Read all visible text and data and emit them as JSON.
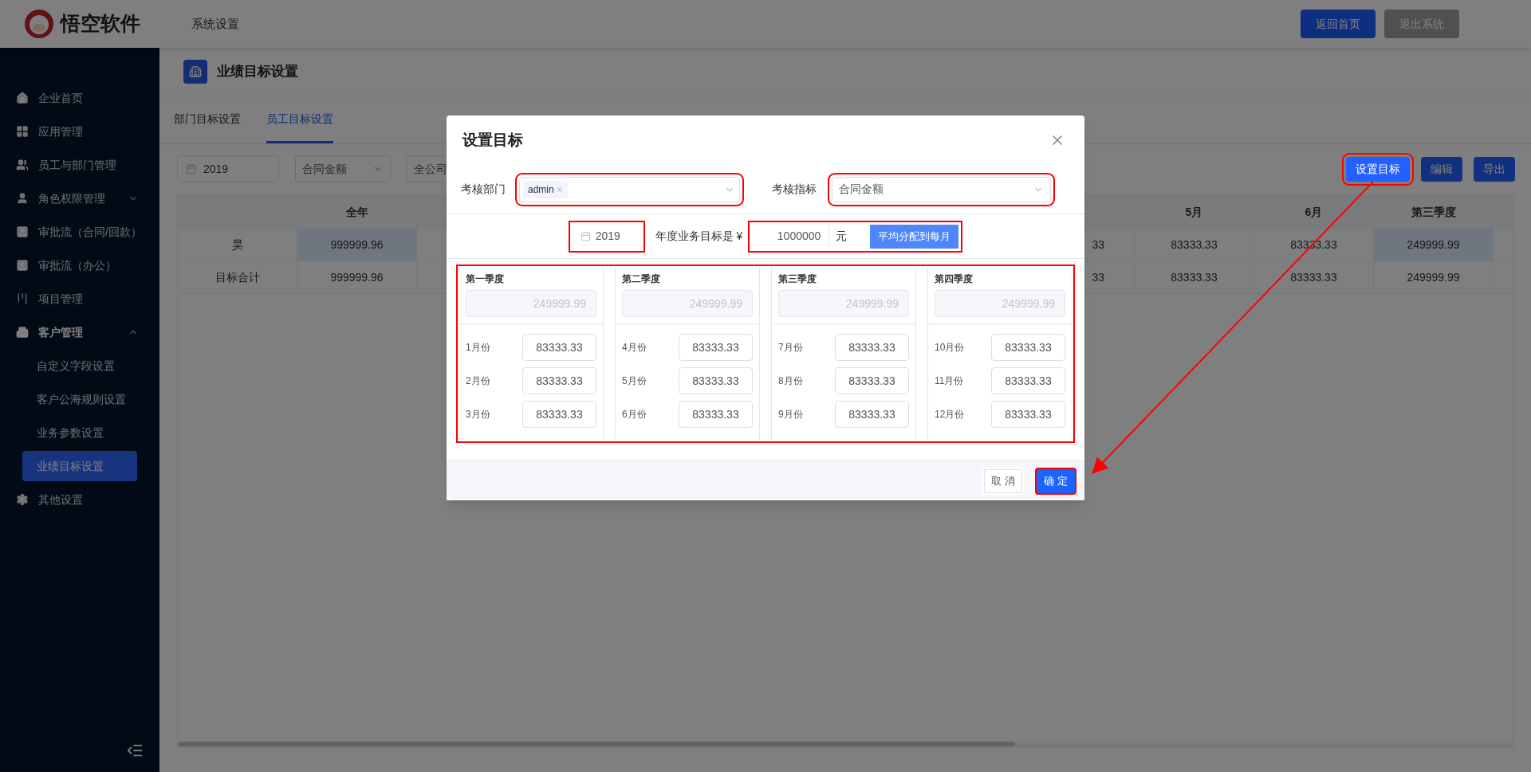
{
  "header": {
    "brand": "悟空软件",
    "section": "系统设置",
    "buttons": [
      {
        "label": "返回首页",
        "disabled": false
      },
      {
        "label": "退出系统",
        "disabled": true
      }
    ]
  },
  "sidebar": {
    "items": [
      {
        "label": "企业首页",
        "selected": false
      },
      {
        "label": "应用管理",
        "selected": false
      },
      {
        "label": "员工与部门管理",
        "selected": false
      },
      {
        "label": "角色权限管理",
        "selected": false,
        "expanded": false
      },
      {
        "label": "审批流（合同/回款）",
        "selected": false
      },
      {
        "label": "审批流（办公）",
        "selected": false
      },
      {
        "label": "项目管理",
        "selected": false
      },
      {
        "label": "客户管理",
        "selected": false,
        "expanded": true,
        "children": [
          {
            "label": "自定义字段设置",
            "selected": false
          },
          {
            "label": "客户公海规则设置",
            "selected": false
          },
          {
            "label": "业务参数设置",
            "selected": false
          },
          {
            "label": "业绩目标设置",
            "selected": true
          }
        ]
      },
      {
        "label": "其他设置",
        "selected": false
      }
    ]
  },
  "page": {
    "title": "业绩目标设置",
    "tabs": [
      {
        "label": "部门目标设置",
        "selected": false
      },
      {
        "label": "员工目标设置",
        "selected": true
      }
    ],
    "filters": {
      "year": "2019",
      "metric": "合同金额",
      "scope": "全公司"
    },
    "actions": [
      {
        "label": "设置目标",
        "annotated": true
      },
      {
        "label": "编辑",
        "annotated": false
      },
      {
        "label": "导出",
        "annotated": false
      }
    ],
    "table": {
      "columns": [
        "全年",
        "5月",
        "6月",
        "第三季度"
      ],
      "rows": [
        {
          "name": "昊",
          "cut_cell": "33",
          "cells": [
            {
              "text": "999999.96",
              "highlighted": true
            },
            {
              "text": "83333.33",
              "highlighted": false
            },
            {
              "text": "83333.33",
              "highlighted": false
            },
            {
              "text": "249999.99",
              "highlighted": true
            }
          ]
        },
        {
          "name": "目标合计",
          "cut_cell": "33",
          "cells": [
            {
              "text": "999999.96",
              "highlighted": false
            },
            {
              "text": "83333.33",
              "highlighted": false
            },
            {
              "text": "83333.33",
              "highlighted": false
            },
            {
              "text": "249999.99",
              "highlighted": false
            }
          ]
        }
      ]
    }
  },
  "dialog": {
    "title": "设置目标",
    "department": {
      "label": "考核部门",
      "tags": [
        "admin"
      ],
      "annotated": true
    },
    "metric": {
      "label": "考核指标",
      "value": "合同金额",
      "annotated": true
    },
    "year": {
      "value": "2019",
      "annotated": true
    },
    "target": {
      "label": "年度业务目标是 ¥",
      "value": "1000000",
      "unit": "元",
      "button": "平均分配到每月",
      "annotated": true
    },
    "quarters_annotated": true,
    "quarters": [
      {
        "title": "第一季度",
        "total": "249999.99",
        "months": [
          {
            "label": "1月份",
            "value": "83333.33"
          },
          {
            "label": "2月份",
            "value": "83333.33"
          },
          {
            "label": "3月份",
            "value": "83333.33"
          }
        ]
      },
      {
        "title": "第二季度",
        "total": "249999.99",
        "months": [
          {
            "label": "4月份",
            "value": "83333.33"
          },
          {
            "label": "5月份",
            "value": "83333.33"
          },
          {
            "label": "6月份",
            "value": "83333.33"
          }
        ]
      },
      {
        "title": "第三季度",
        "total": "249999.99",
        "months": [
          {
            "label": "7月份",
            "value": "83333.33"
          },
          {
            "label": "8月份",
            "value": "83333.33"
          },
          {
            "label": "9月份",
            "value": "83333.33"
          }
        ]
      },
      {
        "title": "第四季度",
        "total": "249999.99",
        "months": [
          {
            "label": "10月份",
            "value": "83333.33"
          },
          {
            "label": "11月份",
            "value": "83333.33"
          },
          {
            "label": "12月份",
            "value": "83333.33"
          }
        ]
      }
    ],
    "buttons": [
      {
        "label": "取 消",
        "kind": "default",
        "annotated": false
      },
      {
        "label": "确 定",
        "kind": "primary",
        "annotated": true
      }
    ]
  }
}
